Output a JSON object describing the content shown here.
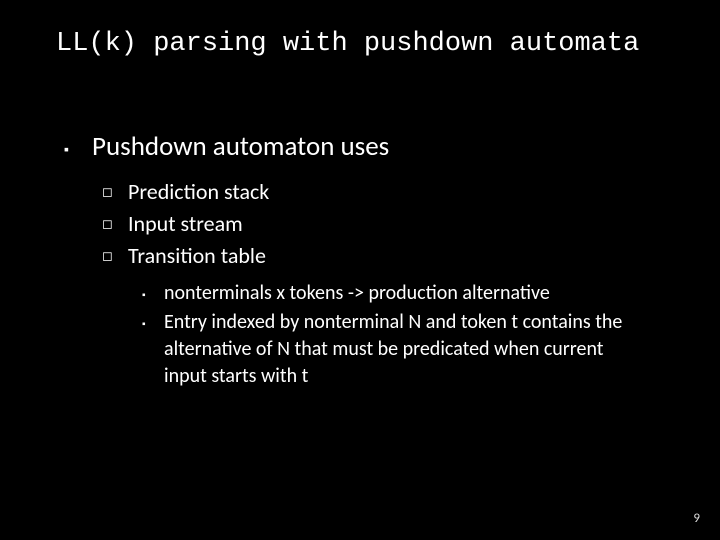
{
  "title": "LL(k) parsing with pushdown automata",
  "l1": {
    "bullet": "▪",
    "text": "Pushdown automaton uses"
  },
  "l2": [
    {
      "bullet": "◻",
      "text": "Prediction stack"
    },
    {
      "bullet": "◻",
      "text": "Input stream"
    },
    {
      "bullet": "◻",
      "text": "Transition table"
    }
  ],
  "l3": [
    {
      "bullet": "▪",
      "text": "nonterminals x tokens -> production alternative"
    },
    {
      "bullet": "▪",
      "text": "Entry indexed by nonterminal N and token t contains the alternative of N that must be predicated when current input starts with t"
    }
  ],
  "pageNumber": "9"
}
